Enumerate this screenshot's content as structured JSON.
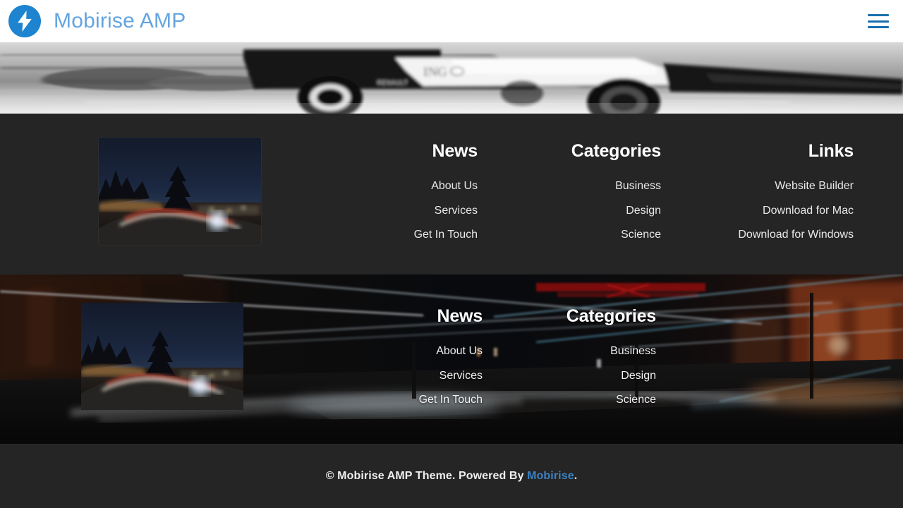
{
  "header": {
    "logo_icon": "amp-bolt-icon",
    "brand_name": "Mobirise AMP",
    "menu_icon": "hamburger-menu-icon",
    "brand_color": "#63a4e0",
    "logo_bg_color": "#1e84cf"
  },
  "hero": {
    "image_alt": "formula-one-race-car-motion-blur-grayscale"
  },
  "footer_plain": {
    "logo_image_alt": "night-road-light-trails-photo",
    "background_color": "#252525",
    "columns": [
      {
        "title": "News",
        "items": [
          "About Us",
          "Services",
          "Get In Touch"
        ]
      },
      {
        "title": "Categories",
        "items": [
          "Business",
          "Design",
          "Science"
        ]
      },
      {
        "title": "Links",
        "items": [
          "Website Builder",
          "Download for Mac",
          "Download for Windows"
        ]
      }
    ]
  },
  "footer_photo": {
    "background_image_alt": "night-city-street-long-exposure-light-trails",
    "logo_image_alt": "night-road-light-trails-photo",
    "columns": [
      {
        "title": "News",
        "items": [
          "About Us",
          "Services",
          "Get In Touch"
        ]
      },
      {
        "title": "Categories",
        "items": [
          "Business",
          "Design",
          "Science"
        ]
      }
    ]
  },
  "copyright": {
    "text_before": "© Mobirise AMP Theme. Powered By ",
    "link_label": "Mobirise",
    "text_after": ".",
    "link_color": "#3c82c4"
  }
}
